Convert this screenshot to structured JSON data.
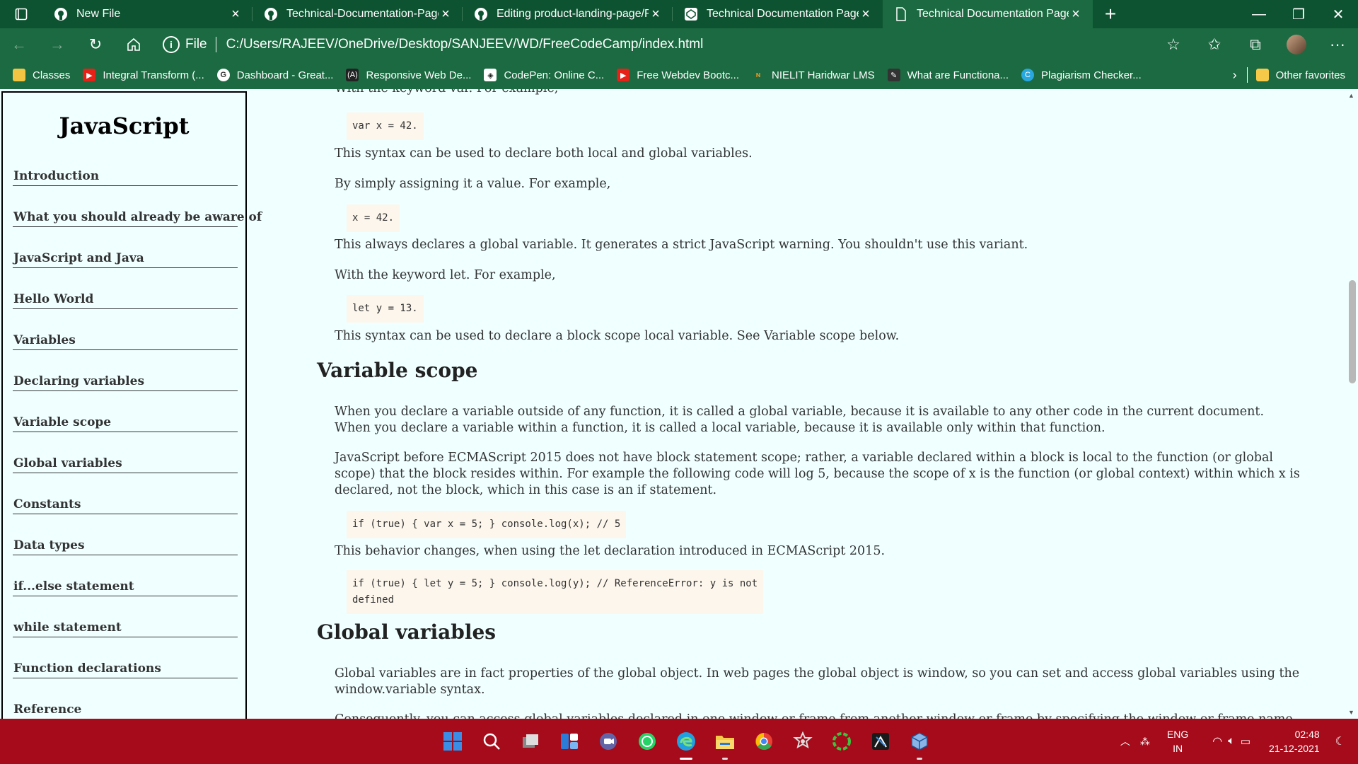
{
  "browser": {
    "tabs": [
      {
        "label": "New File",
        "icon": "github-icon"
      },
      {
        "label": "Technical-Documentation-Page/",
        "icon": "github-icon"
      },
      {
        "label": "Editing product-landing-page/R",
        "icon": "github-icon"
      },
      {
        "label": "Technical Documentation Page",
        "icon": "codepen-icon"
      },
      {
        "label": "Technical Documentation Page",
        "icon": "file-icon",
        "active": true
      }
    ],
    "new_tab": "+",
    "address": {
      "scheme_label": "File",
      "url": "C:/Users/RAJEEV/OneDrive/Desktop/SANJEEV/WD/FreeCodeCamp/index.html"
    },
    "favorites": [
      {
        "label": "Classes",
        "color": "#f4c542"
      },
      {
        "label": "Integral Transform (...",
        "color": "#e62117"
      },
      {
        "label": "Dashboard - Great...",
        "color": "#ffffff"
      },
      {
        "label": "Responsive Web De...",
        "color": "#222222"
      },
      {
        "label": "CodePen: Online C...",
        "color": "#ffffff"
      },
      {
        "label": "Free Webdev Bootc...",
        "color": "#e62117"
      },
      {
        "label": "NIELIT Haridwar LMS",
        "color": "#f7931e"
      },
      {
        "label": "What are Functiona...",
        "color": "#333333"
      },
      {
        "label": "Plagiarism Checker...",
        "color": "#29a8e0"
      }
    ],
    "other_favorites": "Other favorites",
    "colors": {
      "tabbar": "#0e5331",
      "toolbar": "#1b6a41",
      "page_bg": "#f0ffff",
      "taskbar": "#a50b1a"
    }
  },
  "sidebar": {
    "title": "JavaScript",
    "links": [
      "Introduction",
      "What you should already be aware of",
      "JavaScript and Java",
      "Hello World",
      "Variables",
      "Declaring variables",
      "Variable scope",
      "Global variables",
      "Constants",
      "Data types",
      "if...else statement",
      "while statement",
      "Function declarations",
      "Reference"
    ]
  },
  "content": {
    "p_var_intro": "With the keyword var. For example,",
    "code_var": "var x = 42.",
    "p_var_desc": "This syntax can be used to declare both local and global variables.",
    "p_assign_intro": "By simply assigning it a value. For example,",
    "code_assign": "x = 42.",
    "p_assign_desc": "This always declares a global variable. It generates a strict JavaScript warning. You shouldn't use this variant.",
    "p_let_intro": "With the keyword let. For example,",
    "code_let": "let y = 13.",
    "p_let_desc": "This syntax can be used to declare a block scope local variable. See Variable scope below.",
    "h_scope": "Variable scope",
    "p_scope_1": "When you declare a variable outside of any function, it is called a global variable, because it is available to any other code in the current document. When you declare a variable within a function, it is called a local variable, because it is available only within that function.",
    "p_scope_2": "JavaScript before ECMAScript 2015 does not have block statement scope; rather, a variable declared within a block is local to the function (or global scope) that the block resides within. For example the following code will log 5, because the scope of x is the function (or global context) within which x is declared, not the block, which in this case is an if statement.",
    "code_scope_1": "if (true) { var x = 5; } console.log(x); // 5",
    "p_scope_3": "This behavior changes, when using the let declaration introduced in ECMAScript 2015.",
    "code_scope_2a": "if (true) { let y = 5; } console.log(y); // ReferenceError: y is not",
    "code_scope_2b": "defined",
    "h_global": "Global variables",
    "p_global_1": "Global variables are in fact properties of the global object. In web pages the global object is window, so you can set and access global variables using the window.variable syntax.",
    "p_global_2": "Consequently, you can access global variables declared in one window or frame from another window or frame by specifying the window or frame name. For example, if a"
  },
  "taskbar": {
    "apps": [
      {
        "name": "windows-start-icon",
        "color": "#3a8ee6"
      },
      {
        "name": "search-icon",
        "color": "#ffffff"
      },
      {
        "name": "task-view-icon",
        "color": "#cccccc"
      },
      {
        "name": "widgets-icon",
        "color": "#2b7bd9"
      },
      {
        "name": "teams-chat-icon",
        "color": "#6264a7"
      },
      {
        "name": "whatsapp-icon",
        "color": "#25d366"
      },
      {
        "name": "edge-icon",
        "color": "#1fa0e0"
      },
      {
        "name": "file-explorer-icon",
        "color": "#f7c948"
      },
      {
        "name": "chrome-icon",
        "color": "#e94235"
      },
      {
        "name": "settings-gear-icon",
        "color": "#dddddd"
      },
      {
        "name": "circle-app-icon",
        "color": "#3ec33e"
      },
      {
        "name": "kali-app-icon",
        "color": "#222222"
      },
      {
        "name": "virtualbox-icon",
        "color": "#8ab4e8"
      }
    ],
    "lang_top": "ENG",
    "lang_bottom": "IN",
    "time": "02:48",
    "date": "21-12-2021"
  }
}
